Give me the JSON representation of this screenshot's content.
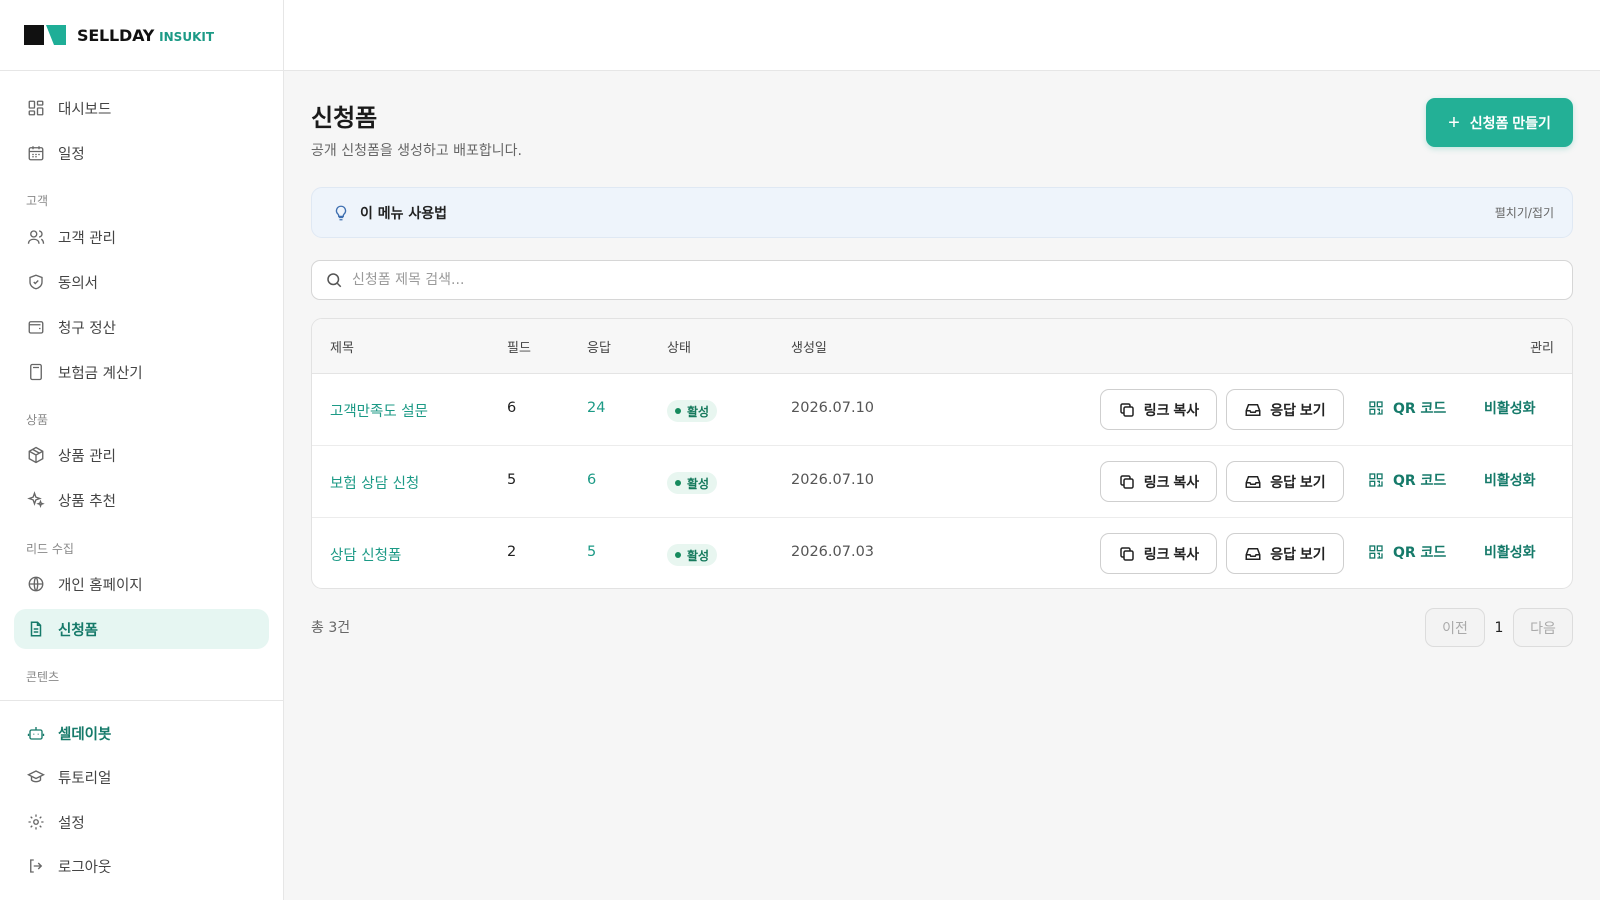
{
  "brand": {
    "name": "SELLDAY",
    "sub": "INSUKIT"
  },
  "sidebar": {
    "items": [
      {
        "label": "대시보드"
      },
      {
        "label": "일정"
      },
      {
        "label": "고객 관리"
      },
      {
        "label": "동의서"
      },
      {
        "label": "청구 정산"
      },
      {
        "label": "보험금 계산기"
      },
      {
        "label": "상품 관리"
      },
      {
        "label": "상품 추천"
      },
      {
        "label": "개인 홈페이지"
      },
      {
        "label": "신청폼"
      }
    ],
    "sections": [
      "고객",
      "상품",
      "리드 수집",
      "콘텐츠"
    ],
    "bottom": [
      {
        "label": "셀데이봇"
      },
      {
        "label": "튜토리얼"
      },
      {
        "label": "설정"
      },
      {
        "label": "로그아웃"
      }
    ]
  },
  "page": {
    "title": "신청폼",
    "subtitle": "공개 신청폼을 생성하고 배포합니다.",
    "create_label": "신청폼 만들기"
  },
  "howto": {
    "title": "이 메뉴 사용법",
    "toggle": "펼치기/접기"
  },
  "search": {
    "placeholder": "신청폼 제목 검색..."
  },
  "table": {
    "headers": [
      "제목",
      "필드",
      "응답",
      "상태",
      "생성일",
      "관리"
    ],
    "rows": [
      {
        "title": "고객만족도 설문",
        "fields": "6",
        "responses": "24",
        "status": "활성",
        "created": "2026.07.10"
      },
      {
        "title": "보험 상담 신청",
        "fields": "5",
        "responses": "6",
        "status": "활성",
        "created": "2026.07.10"
      },
      {
        "title": "상담 신청폼",
        "fields": "2",
        "responses": "5",
        "status": "활성",
        "created": "2026.07.03"
      }
    ],
    "actions": {
      "copy_link": "링크 복사",
      "view_responses": "응답 보기",
      "qr": "QR 코드",
      "deactivate": "비활성화"
    }
  },
  "footer": {
    "total": "총 3건",
    "prev": "이전",
    "page": "1",
    "next": "다음"
  },
  "colors": {
    "accent": "#23b096",
    "accent_text": "#167a6a",
    "active_bg": "#e6f6f2"
  }
}
